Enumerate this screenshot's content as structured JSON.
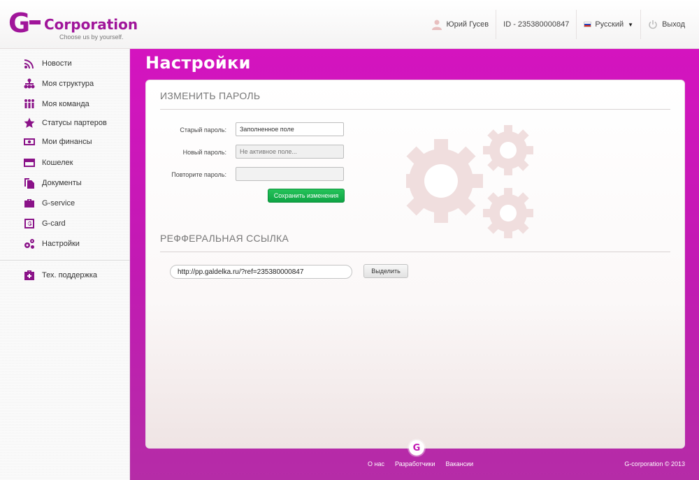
{
  "header": {
    "logo_g": "G",
    "logo_word": "Corporation",
    "tagline": "Choose us by yourself.",
    "user_name": "Юрий Гусев",
    "user_id": "ID - 235380000847",
    "language": "Русский",
    "logout": "Выход"
  },
  "sidebar": {
    "items": [
      {
        "label": "Новости",
        "icon": "rss-icon"
      },
      {
        "label": "Моя структура",
        "icon": "structure-icon"
      },
      {
        "label": "Моя команда",
        "icon": "team-icon"
      },
      {
        "label": "Статусы партеров",
        "icon": "star-icon"
      },
      {
        "label": "Мои финансы",
        "icon": "money-icon"
      },
      {
        "label": "Кошелек",
        "icon": "wallet-icon"
      },
      {
        "label": "Документы",
        "icon": "documents-icon"
      },
      {
        "label": "G-service",
        "icon": "briefcase-icon"
      },
      {
        "label": "G-card",
        "icon": "card-icon"
      },
      {
        "label": "Настройки",
        "icon": "gears-icon"
      }
    ],
    "support": {
      "label": "Тех. поддержка",
      "icon": "medkit-icon"
    }
  },
  "main": {
    "title": "Настройки",
    "password_section": {
      "title": "ИЗМЕНИТЬ ПАРОЛЬ",
      "old_label": "Старый пароль:",
      "old_value": "Заполненное поле",
      "new_label": "Новый пароль:",
      "new_placeholder": "Не активное поле...",
      "repeat_label": "Повторите пароль:",
      "repeat_value": "",
      "save_label": "Сохранить изменения"
    },
    "referral_section": {
      "title": "РЕФФЕРАЛЬНАЯ ССЫЛКА",
      "link": "http://pp.galdelka.ru/?ref=235380000847",
      "select_label": "Выделить"
    }
  },
  "footer": {
    "logo_letter": "G",
    "links": [
      "О нас",
      "Разработчики",
      "Вакансии"
    ],
    "copyright": "G-corporation © 2013"
  },
  "colors": {
    "brand": "#a0159a",
    "main_bg": "#c21ab3",
    "save_button": "#18b34e",
    "gear": "#f0dede"
  }
}
